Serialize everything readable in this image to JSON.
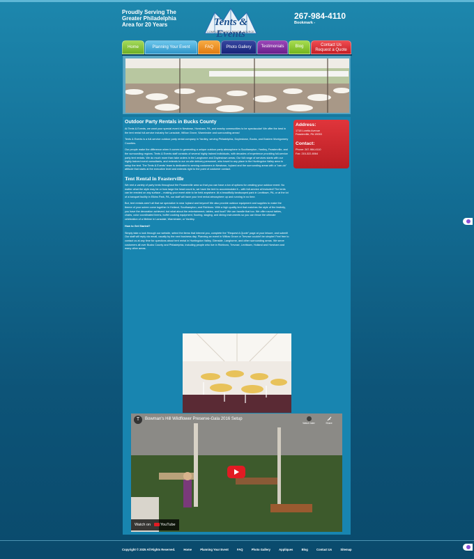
{
  "header": {
    "tagline": "Proudly Serving The Greater Philadelphia Area for 20 Years",
    "logo_text": "Tents & Events",
    "logo_subtitle": "COMPLETE PARTY RENTAL SOURCE",
    "phone": "267-984-4110",
    "bookmark": "Bookmark -"
  },
  "nav": {
    "tabs": [
      {
        "label": "Home",
        "color": "#7cbf2f"
      },
      {
        "label": "Planning Your Event",
        "color": "#3fa9d8"
      },
      {
        "label": "FAQ",
        "color": "#f08a1c"
      },
      {
        "label": "Photo Gallery",
        "color": "#1c2a86"
      },
      {
        "label": "Testimonials",
        "color": "#7d2a9c"
      },
      {
        "label": "Blog",
        "color": "#86c229"
      },
      {
        "label": "Contact Us",
        "label2": "Request a Quote",
        "color": "#d82a30"
      }
    ]
  },
  "main": {
    "title": "Outdoor Party Rentals in Bucks County",
    "p1": "At Tents & Events, we want your special event in Newtown, Horsham, PA, and nearby communities to be spectacular! We offer the best in the tent rental full-service industry for Lansdale, Willow Grove, Warminster and surrounding areas!",
    "p2": "Tents & Events is a full-service outdoor party rental company in Yardley, serving Philadelphia, Doylestown, Bucks, and Eastern Montgomery Counties.",
    "p3": "Our people make the difference when it comes to generating a unique outdoor party atmosphere in Southampton, Yardley, Feasterville, and the surrounding regions.   Tents & Events staff consists of several highly trained individuals, with decades of experience providing full-service party tent rentals. We do much more than take orders in the Langhorne and Doylestown areas; Our full range of services starts with our highly trained event consultants, and extends to our on-site delivery personnel, who travel to any place in the Huntingdon Valley area to setup the tent. The Tents & Events' team is dedicated to serving customers in Newtown, Ivyland and the surrounding areas with a \"can-do\" attitude that starts at the executive level and extends right to the point of customer contact.",
    "subtitle": "Tent Rental in Feasterville",
    "p4": "We rent a variety of party tents throughout the Feasterville area so that you can have a ton of options for creating your outdoor event. No matter what the style may be or how large the head count is, we have the tent to accommodate it – with full-service all included! The tents can be erected on any surface – making your event able to be held anywhere. At a beautifully landscaped park in Levittown, PA, or at the lot of a banquet facility in Elkins Park, PA, our staff will have your tent rental atmosphere up and running in no time.",
    "p5": "But, tent rentals aren't all that we specialize in near Ivyland and beyond! We also provide outdoor equipment and supplies to make the theme of your soiree come together in Holland, Southampton, and Richboro. With a high quality tent that matches the style of the festivity, you have the decoration achieved; but what about the entertainment, tables, and food? We can handle that too. We offer round tables, chairs, color coordinated linens, buffet cooking equipment, flooring, staging, and dining instruments so you can throw the ultimate celebration of a lifetime in Lansdale, Warminster, or Yardley.",
    "heading3": "How to Get Started?",
    "p6": "Simply take a look through our website, select the items that interest you, complete the \"Request A Quote\" page at your leisure, and submit! Our staff will reply via email, usually by the next business day. Planning an event in Willow Grove or Trevose couldn't be simpler! Feel free to contact us at any time for questions about tent rental in Huntingdon Valley, Glenside, Langhorne, and other surrounding areas. We serve customers all over Bucks County and Philadelphia, including people who live in Richboro, Trevose, Levittown, Holland and Horsham and many other areas."
  },
  "sidebar": {
    "address_label": "Address:",
    "address_line1": "1718 Loretta Avenue",
    "address_line2": "Feasterville, PA 19053",
    "contact_label": "Contact:",
    "phone_line": "Phone: 267-984-4110",
    "fax_line": "Fax: 215-322-8064"
  },
  "video": {
    "channel_initial": "T",
    "title": "Bowman's Hill Wildflower Preserve-Gala 2016 Setup",
    "watch_later": "Watch later",
    "share": "Share",
    "watch_on": "Watch on",
    "youtube": "YouTube"
  },
  "footer": {
    "copyright": "Copyright © 2025 All Rights Reserved.",
    "links": [
      "Home",
      "Planning Your Event",
      "FAQ",
      "Photo Gallery",
      "Appliques",
      "Blog",
      "Contact Us",
      "Sitemap"
    ]
  }
}
